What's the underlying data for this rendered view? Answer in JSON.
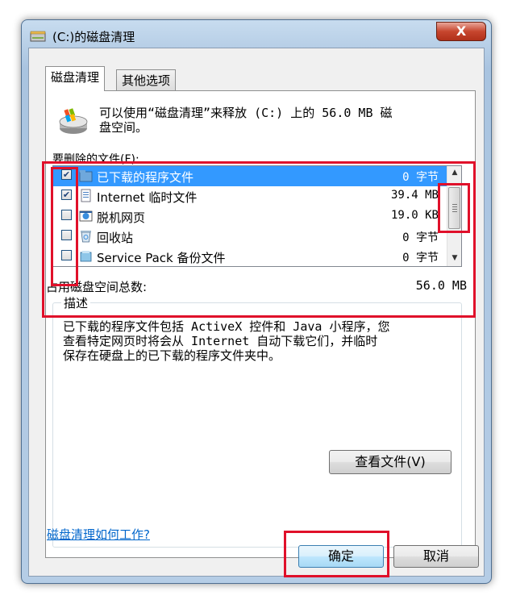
{
  "window": {
    "title": "(C:)的磁盘清理",
    "close_glyph": "X"
  },
  "tabs": [
    {
      "label": "磁盘清理",
      "active": true
    },
    {
      "label": "其他选项",
      "active": false
    }
  ],
  "header": {
    "line1": "可以使用“磁盘清理”来释放  (C:) 上的 56.0 MB 磁",
    "line2": "盘空间。"
  },
  "files_label": "要删除的文件(F):",
  "files": [
    {
      "name": "已下载的程序文件",
      "size": "0 字节",
      "checked": true,
      "selected": true,
      "icon": "folder-icon"
    },
    {
      "name": "Internet 临时文件",
      "size": "39.4 MB",
      "checked": true,
      "selected": false,
      "icon": "document-icon"
    },
    {
      "name": "脱机网页",
      "size": "19.0 KB",
      "checked": false,
      "selected": false,
      "icon": "offline-pages-icon"
    },
    {
      "name": "回收站",
      "size": "0 字节",
      "checked": false,
      "selected": false,
      "icon": "recycle-bin-icon"
    },
    {
      "name": "Service Pack 备份文件",
      "size": "0 字节",
      "checked": false,
      "selected": false,
      "icon": "backup-icon"
    }
  ],
  "total": {
    "label": "占用磁盘空间总数:",
    "value": "56.0 MB"
  },
  "description": {
    "legend": "描述",
    "line1": "已下载的程序文件包括 ActiveX 控件和 Java 小程序，您",
    "line2": "查看特定网页时将会从 Internet 自动下载它们，并临时",
    "line3": "保存在硬盘上的已下载的程序文件夹中。"
  },
  "buttons": {
    "view_files": "查看文件(V)",
    "ok": "确定",
    "cancel": "取消"
  },
  "help_link": "磁盘清理如何工作?",
  "colors": {
    "selection": "#3399ff",
    "highlight": "#e0102a",
    "link": "#0066cc"
  }
}
